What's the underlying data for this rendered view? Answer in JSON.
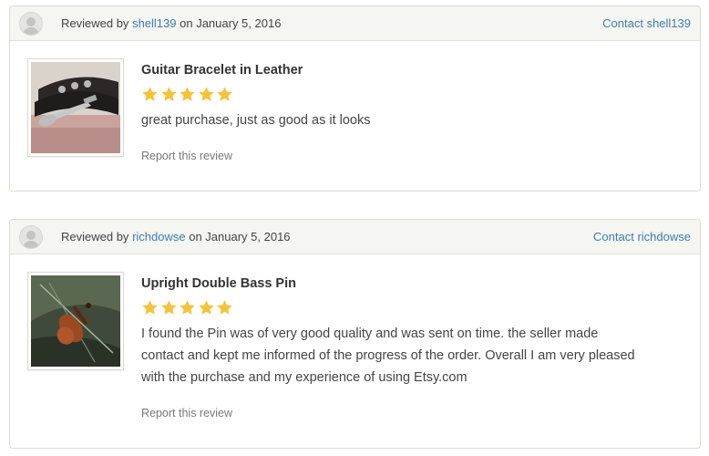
{
  "reviews": [
    {
      "reviewed_prefix": "Reviewed by",
      "username": "shell139",
      "date_text": "on January 5, 2016",
      "contact_label": "Contact shell139",
      "item_title": "Guitar Bracelet in Leather",
      "rating": 5,
      "review_text": "great purchase, just as good as it looks",
      "report_label": "Report this review"
    },
    {
      "reviewed_prefix": "Reviewed by",
      "username": "richdowse",
      "date_text": "on January 5, 2016",
      "contact_label": "Contact richdowse",
      "item_title": "Upright Double Bass Pin",
      "rating": 5,
      "review_text": "I found the Pin was of very good quality and was sent on time. the seller made contact and kept me informed of the progress of the order. Overall I am very pleased with the purchase and my experience of using Etsy.com",
      "report_label": "Report this review"
    }
  ],
  "colors": {
    "link": "#3c7fb1",
    "star": "#f5c33b",
    "header_bg": "#f5f5f1"
  }
}
